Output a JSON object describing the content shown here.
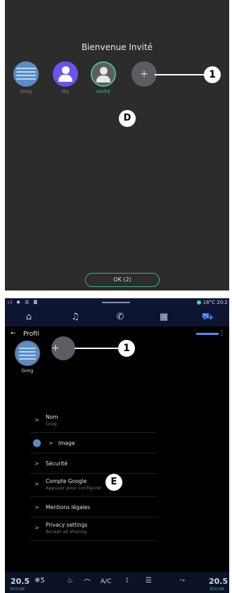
{
  "top_screen": {
    "title": "Bienvenue Invité",
    "profiles": [
      {
        "name": "Greg",
        "icon": "ocean-avatar-icon"
      },
      {
        "name": "My",
        "icon": "person-avatar-icon"
      },
      {
        "name": "Invité",
        "icon": "guest-avatar-icon",
        "selected": true
      },
      {
        "name": "",
        "icon": "plus-icon"
      }
    ],
    "add_symbol": "+",
    "callout_1": "1",
    "callout_d": "D",
    "ok_button": "OK (2)"
  },
  "bottom_screen": {
    "status": {
      "left_icons": "ıl ✱ ☰ ◘",
      "temperature": "16°C",
      "time": "20:2"
    },
    "nav_tabs": [
      {
        "name": "home",
        "glyph": "⌂"
      },
      {
        "name": "music",
        "glyph": "♫"
      },
      {
        "name": "phone",
        "glyph": "✆"
      },
      {
        "name": "apps",
        "glyph": "▦"
      },
      {
        "name": "vehicle",
        "glyph": "⛟",
        "active": true
      }
    ],
    "header": {
      "back": "←",
      "title": "Profil",
      "more": "⋮"
    },
    "profile": {
      "name": "Greg"
    },
    "add_symbol": "+",
    "callout_1": "1",
    "callout_e": "E",
    "menu": [
      {
        "title": "Nom",
        "subtitle": "Greg"
      },
      {
        "title": "Image",
        "subtitle": ""
      },
      {
        "title": "Sécurité",
        "subtitle": ""
      },
      {
        "title": "Compte Google",
        "subtitle": "Appuyer pour configurer"
      },
      {
        "title": "Mentions légales",
        "subtitle": ""
      },
      {
        "title": "Privacy settings",
        "subtitle": "Accept all sharing"
      }
    ],
    "chevron": ">",
    "bottom_bar": {
      "temp_left": "20.5",
      "eco_left": "ECO ON",
      "fan": "❄5",
      "seat_heat": "♨",
      "climate": "⌒",
      "ac": "A/C",
      "seat": "⟟",
      "defrost": "☰",
      "airflow": "⤳",
      "temp_right": "20.5",
      "eco_right": "ECO ON"
    }
  },
  "colors": {
    "accent_green": "#4fb888",
    "accent_blue": "#4e8df5",
    "avatar_purple": "#6a54f0",
    "avatar_ocean": "#5b8cc9"
  }
}
